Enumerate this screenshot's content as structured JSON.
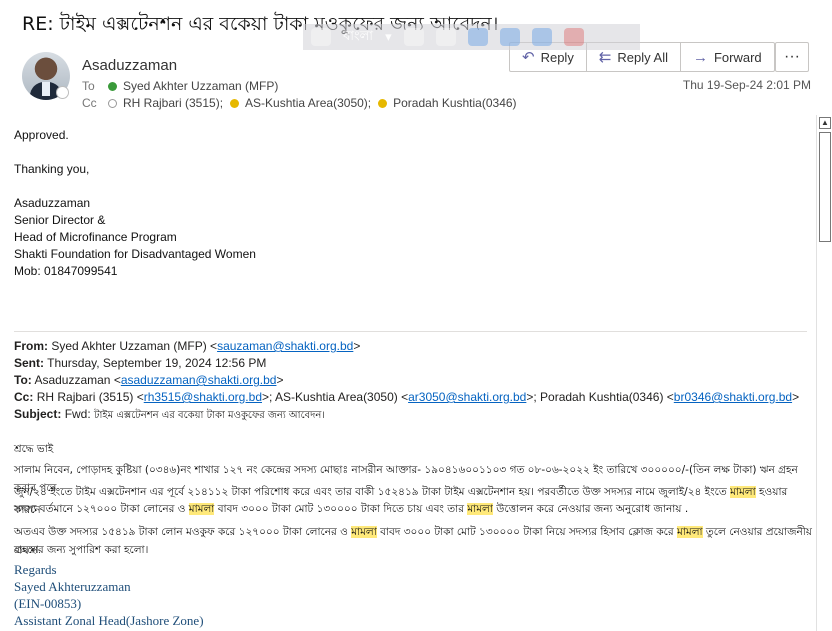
{
  "header": {
    "subject": "RE: টাইম এক্সটেনশন এর বকেয়া টাকা মওকুফের জন্য আবেদন।",
    "sender": "Asaduzzaman",
    "to_label": "To",
    "to": "Syed Akhter Uzzaman (MFP)",
    "cc_label": "Cc",
    "cc": [
      "RH Rajbari (3515);",
      "AS-Kushtia Area(3050);",
      "Poradah Kushtia(0346)"
    ],
    "date": "Thu 19-Sep-24 2:01 PM"
  },
  "actions": {
    "reply": "Reply",
    "reply_all": "Reply All",
    "forward": "Forward",
    "more": "···"
  },
  "language_bar": {
    "language": "বাংলা"
  },
  "reply_body": {
    "line1": "Approved.",
    "line2": "Thanking you,",
    "sig": [
      "Asaduzzaman",
      "Senior Director &",
      "Head of Microfinance Program",
      "Shakti Foundation for Disadvantaged Women",
      "Mob: 01847099541"
    ]
  },
  "forwarded": {
    "from_label": "From:",
    "from_name": "Syed Akhter Uzzaman (MFP) <",
    "from_email": "sauzaman@shakti.org.bd",
    "from_end": ">",
    "sent_label": "Sent:",
    "sent": "Thursday, September 19, 2024 12:56 PM",
    "to_label": "To:",
    "to_name": "Asaduzzaman <",
    "to_email": "asaduzzaman@shakti.org.bd",
    "to_end": ">",
    "cc_label": "Cc:",
    "cc_1": "RH Rajbari (3515) <",
    "cc_1_email": "rh3515@shakti.org.bd",
    "cc_2": ">; AS-Kushtia Area(3050) <",
    "cc_2_email": "ar3050@shakti.org.bd",
    "cc_3": ">; Poradah Kushtia(0346) <",
    "cc_3_email": "br0346@shakti.org.bd",
    "cc_end": ">",
    "subject_label": "Subject:",
    "subject_prefix": "Fwd: ",
    "subject": "টাইম এক্সটেনশন এর বকেয়া টাকা মওকুফের জন্য আবেদন।"
  },
  "letter": {
    "greeting": "শ্রদ্ধে ভাই",
    "p1a": "সালাম নিবেন, পোড়াদহ কুষ্টিয়া (০৩৪৬)নং শাখার ১২৭  নং কেন্দ্রের সদস্য মোছাঃ নাসরীন আক্তার- ১৯০৪১৬০০১১০৩ গত ০৮-০৬-২০২২ ইং তারিখে ৩০০০০০/-(তিন লক্ষ টাকা) ঋন গ্রহন করার পরে",
    "p1b_pre": "জুন/২৪ ইংতে টাইম এক্সটেনশান এর পূর্বে ২১৪১১২ টাকা পরিশোধ করে এবং তার বাকী ১৫২৪১৯ টাকা টাইম এক্সটেনশান হয়। পরবর্তীতে উক্ত সদস্যর নামে জুলাই/২৪ ইংতে ",
    "hl1": "মামলা",
    "p1b_post": " হওয়ার কারনে",
    "p1c_pre": "সদস্য বর্তমানে ১২৭০০০ টাকা লোনের ও ",
    "hl2": "মামলা",
    "p1c_mid": " বাবদ ৩০০০ টাকা মোট ১৩০০০০ টাকা দিতে চায় এবং তার ",
    "hl3": "মামলা",
    "p1c_post": " উত্তোলন করে নেওয়ার জন্য অনুরোধ জানায় .",
    "p2a_pre": " অতএব উক্ত সদস্যর ১৫৪১৯ টাকা লোন মওকুফ করে ১২৭০০০ টাকা লোনের ও ",
    "hl4": "মামলা",
    "p2a_mid": " বাবদ ৩০০০ টাকা মোট ১৩০০০০ টাকা নিয়ে সদস্যর হিসাব ক্লোজ করে ",
    "hl5": "মামলা",
    "p2a_post": " তুলে নেওয়ার প্রয়োজনীয় ব্যবস্থা",
    "p2b": "গ্রহনের জন্য সুপারিশ করা হলো।"
  },
  "signature": {
    "lines": [
      "Regards",
      "Sayed Akhteruzzaman",
      "(EIN-00853)",
      "Assistant Zonal Head(Jashore Zone)"
    ]
  }
}
